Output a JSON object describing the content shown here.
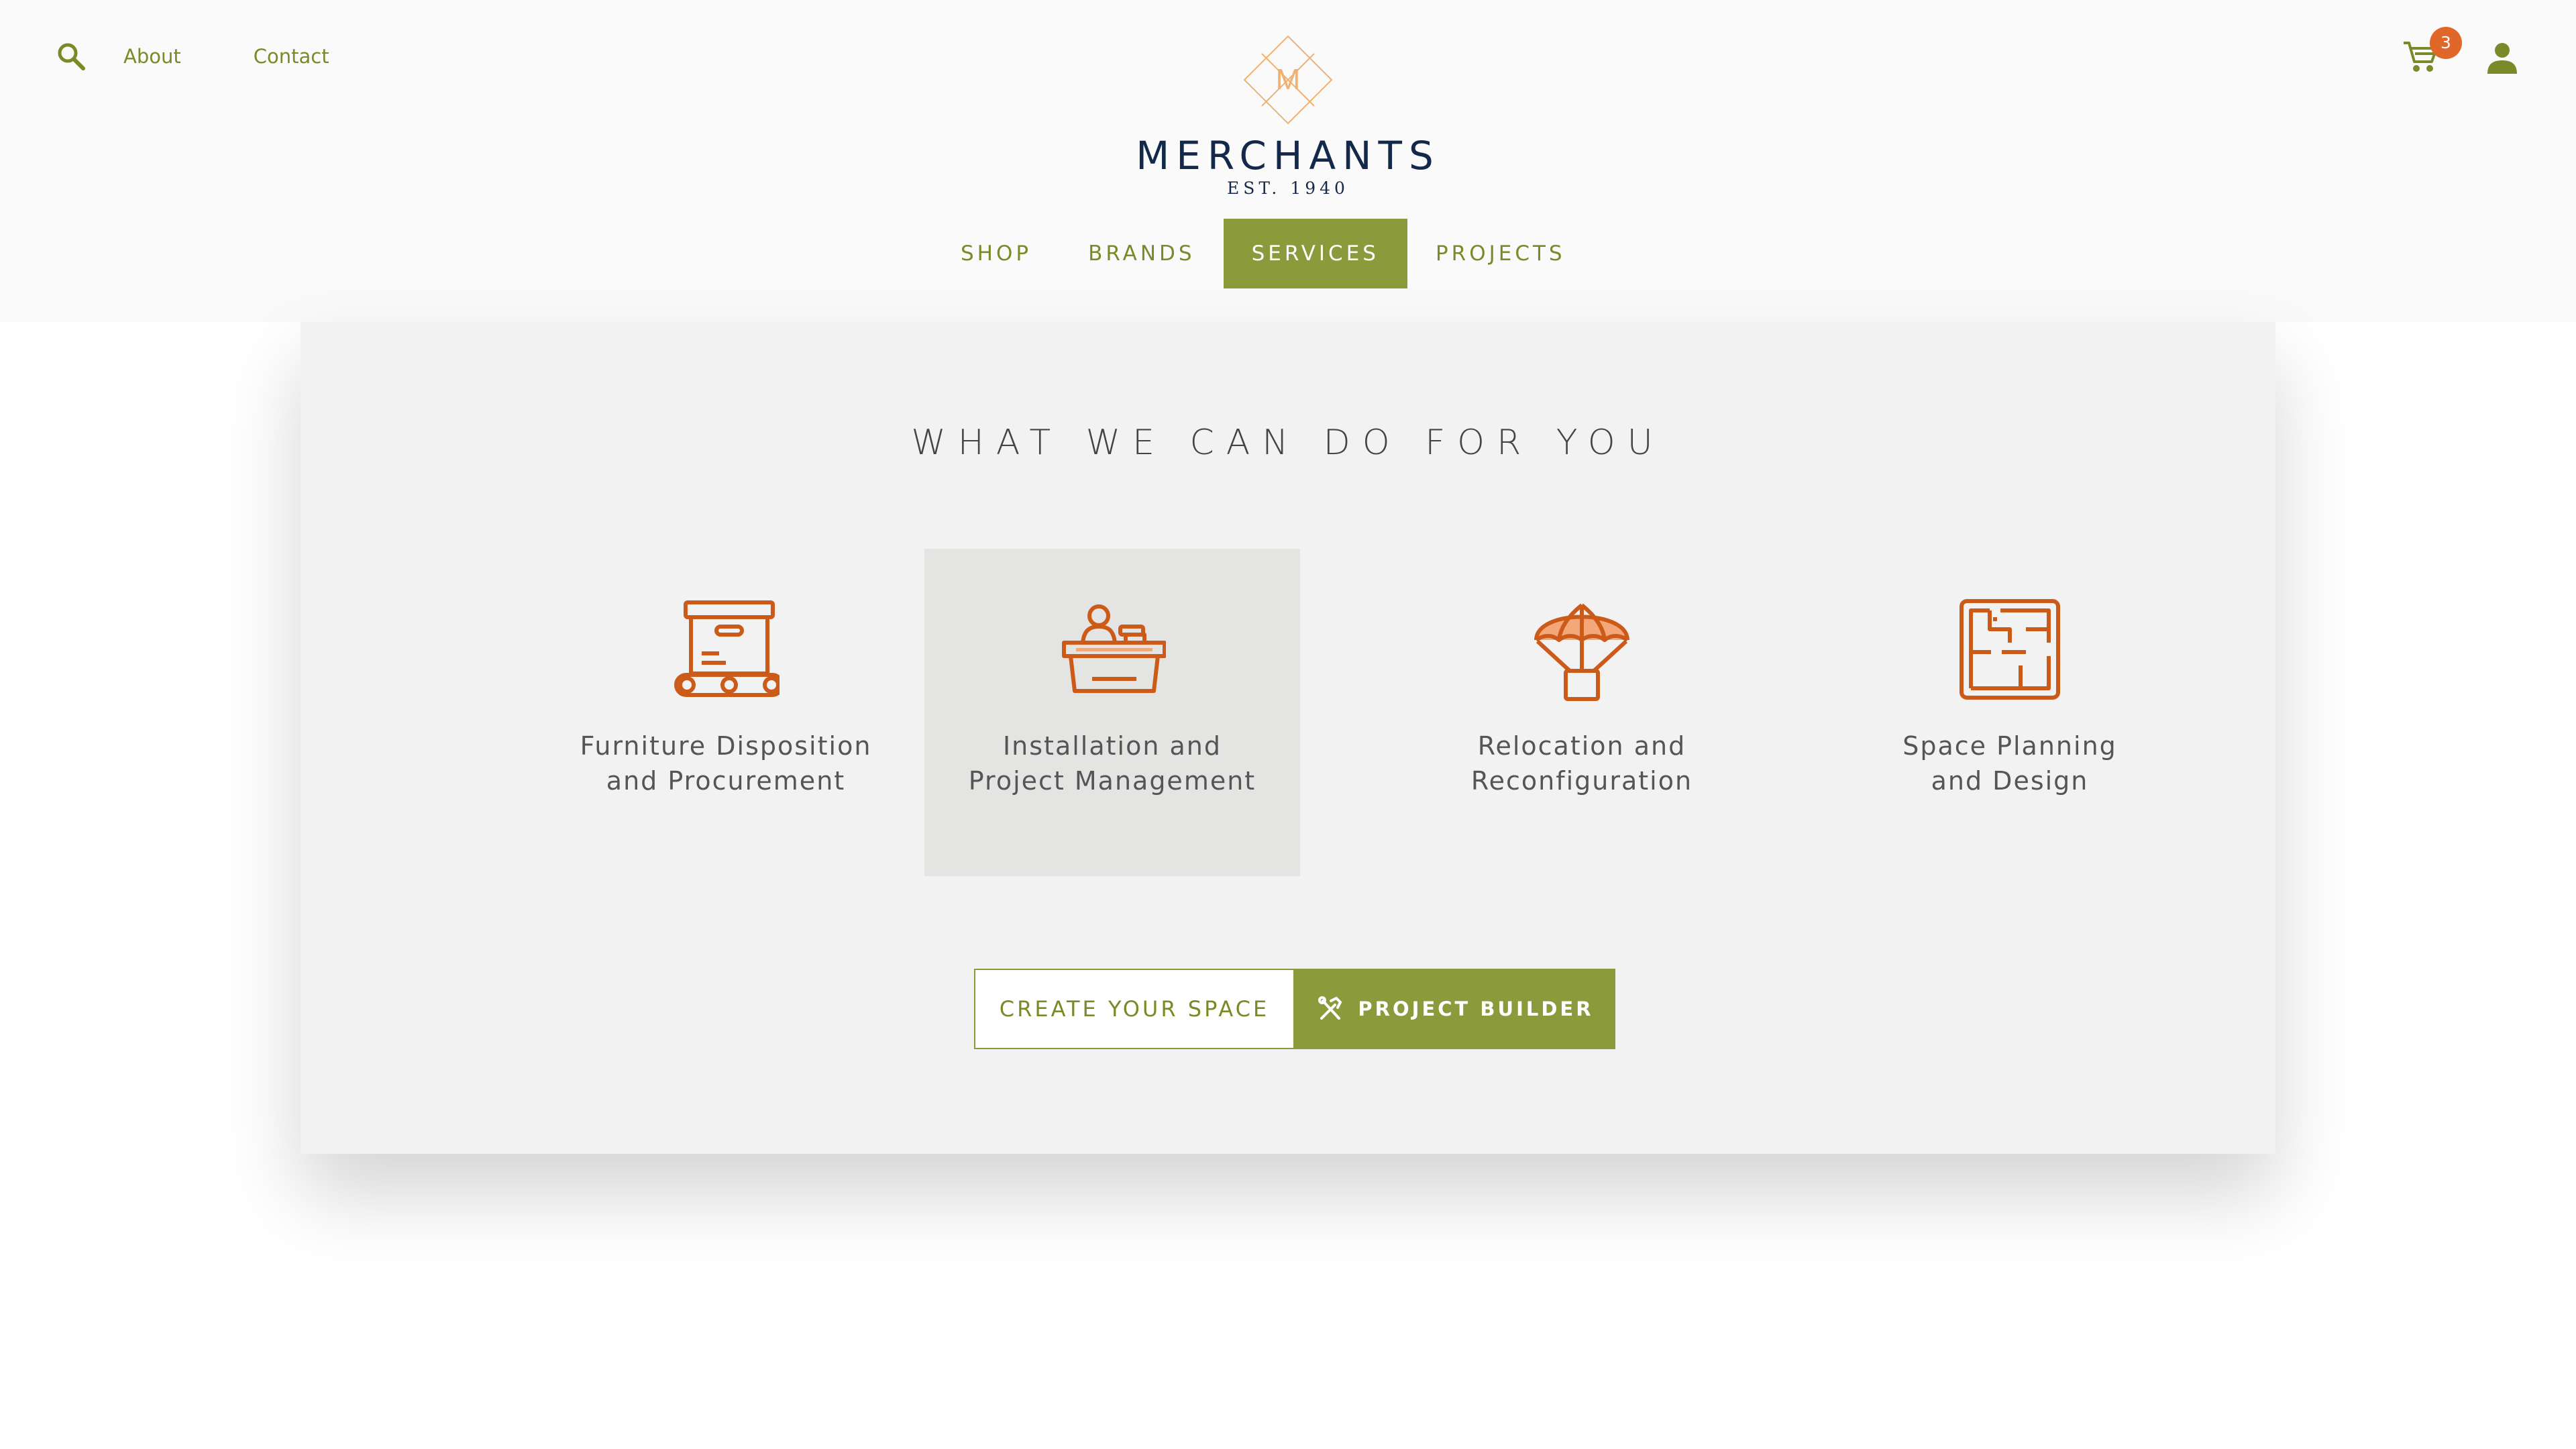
{
  "colors": {
    "accent": "#8b9a3a",
    "orange": "#e0662a",
    "icon_orange": "#cc5a18",
    "navy": "#14294a"
  },
  "header": {
    "links": {
      "about": "About",
      "contact": "Contact"
    },
    "icons": [
      "search-icon",
      "cart-icon",
      "user-icon"
    ],
    "cart_count": "3",
    "logo": {
      "mark_letter": "M",
      "name": "MERCHANTS",
      "est": "EST. 1940"
    }
  },
  "nav": {
    "shop": "SHOP",
    "brands": "BRANDS",
    "services": "SERVICES",
    "projects": "PROJECTS",
    "active": "SERVICES"
  },
  "main": {
    "title": "WHAT WE CAN DO FOR YOU",
    "services": [
      {
        "icon": "conveyor-box-icon",
        "line1": "Furniture Disposition",
        "line2": "and Procurement"
      },
      {
        "icon": "reception-desk-icon",
        "line1": "Installation and",
        "line2": "Project Management"
      },
      {
        "icon": "parachute-box-icon",
        "line1": "Relocation and",
        "line2": "Reconfiguration"
      },
      {
        "icon": "floor-plan-icon",
        "line1": "Space Planning",
        "line2": "and Design"
      }
    ],
    "buttons": {
      "create": "CREATE YOUR SPACE",
      "builder": "PROJECT BUILDER"
    }
  }
}
